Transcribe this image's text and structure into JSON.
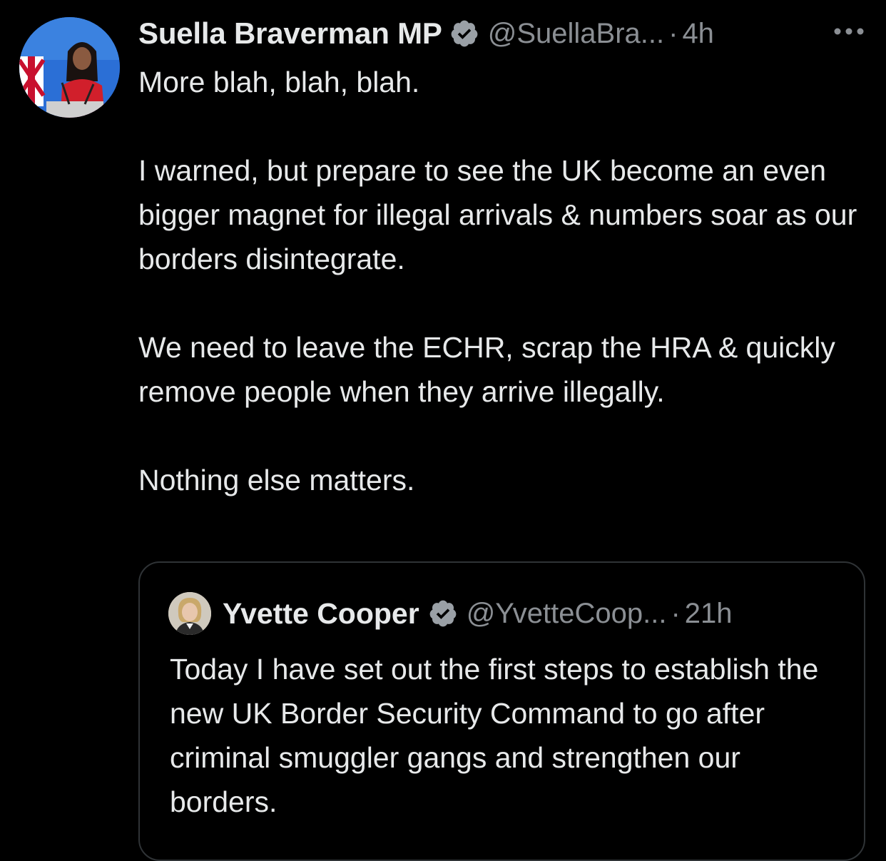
{
  "tweet": {
    "display_name": "Suella Braverman MP",
    "handle": "@SuellaBra...",
    "separator": "·",
    "time": "4h",
    "paragraphs": [
      "More blah, blah, blah.",
      "I warned, but prepare to see the UK become an even bigger magnet for illegal arrivals & numbers soar as our borders disintegrate.",
      "We need to leave the ECHR, scrap the HRA & quickly remove people when they arrive illegally.",
      "Nothing else matters."
    ]
  },
  "quoted_tweet": {
    "display_name": "Yvette Cooper",
    "handle": "@YvetteCoop...",
    "separator": "·",
    "time": "21h",
    "text": "Today I have set out the first steps to establish the new UK Border Security Command to go after criminal smuggler gangs and strengthen our borders."
  },
  "icons": {
    "verified": "verified-badge-icon",
    "more": "more-options-icon"
  },
  "colors": {
    "background": "#000000",
    "text_primary": "#e7e9ea",
    "text_secondary": "#8b8f94",
    "border": "#2f3336",
    "verified_badge": "#9aa0a6"
  }
}
